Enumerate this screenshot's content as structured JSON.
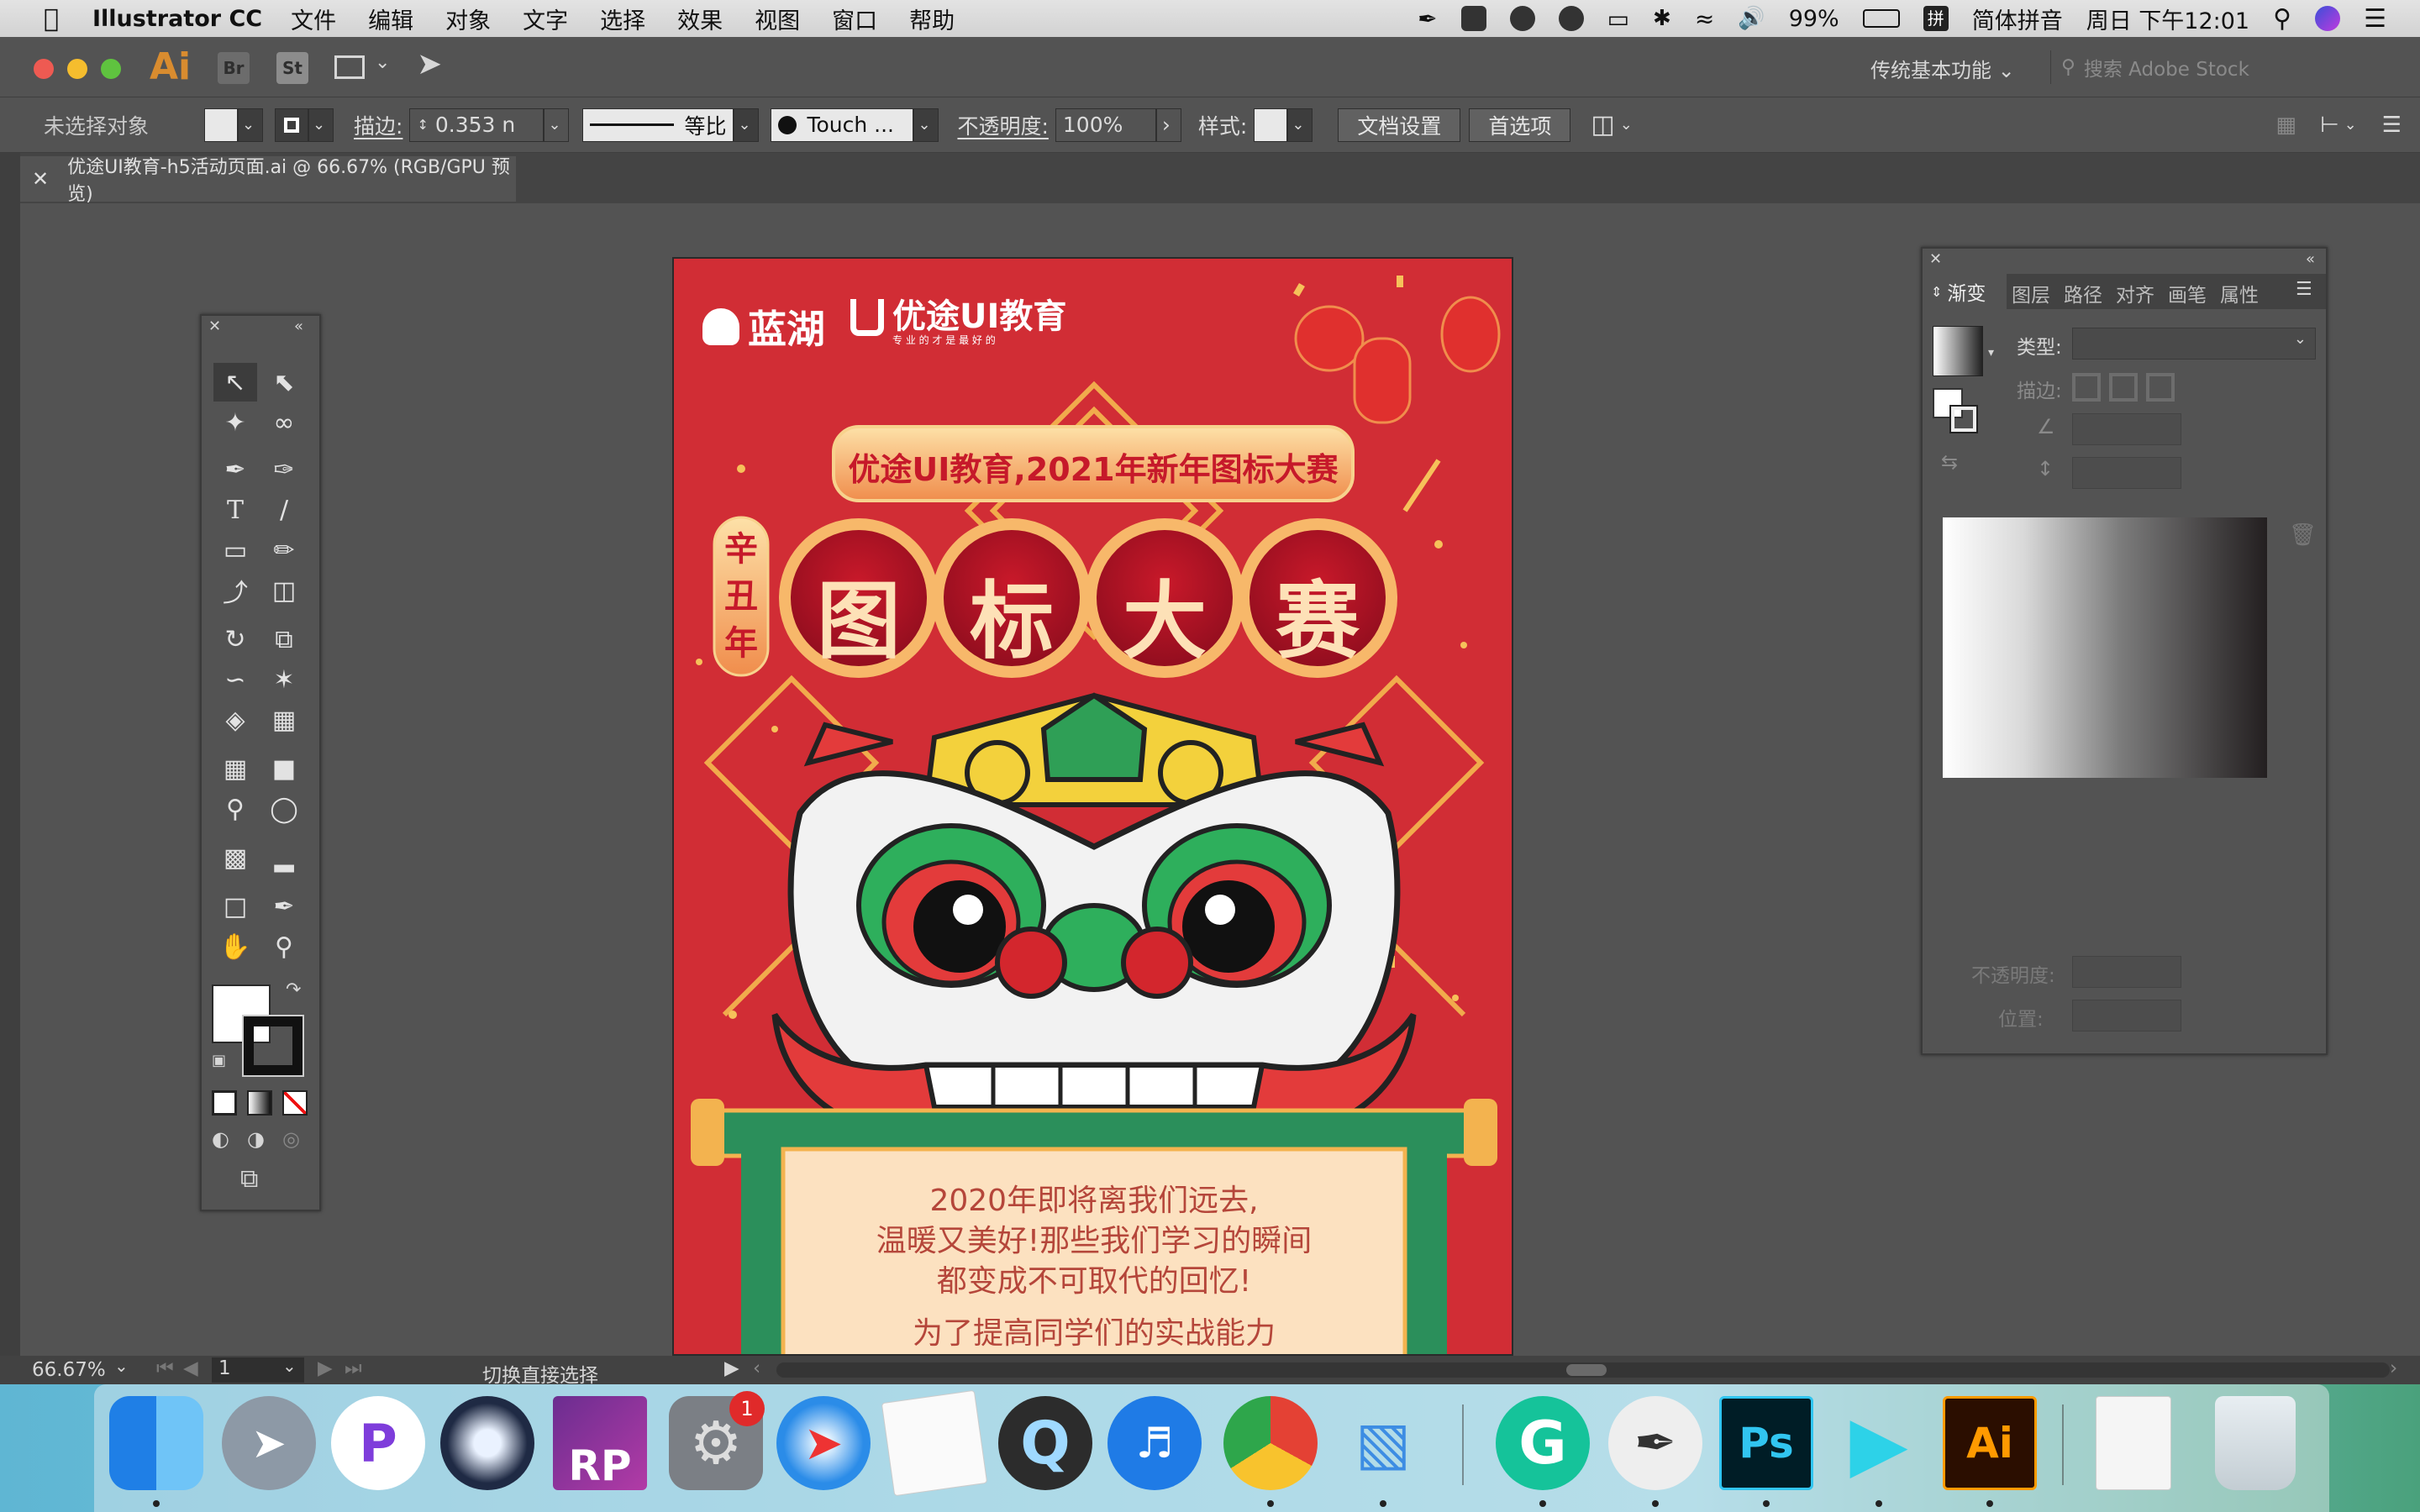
{
  "menubar": {
    "app_name": "Illustrator CC",
    "items": [
      "文件",
      "编辑",
      "对象",
      "文字",
      "选择",
      "效果",
      "视图",
      "窗口",
      "帮助"
    ],
    "battery": "99%",
    "input_method": "简体拼音",
    "datetime": "周日 下午12:01"
  },
  "appbar": {
    "logo": "Ai",
    "bridge": "Br",
    "stock": "St",
    "workspace": "传统基本功能",
    "search_placeholder": "搜索 Adobe Stock"
  },
  "controlbar": {
    "selection": "未选择对象",
    "stroke_label": "描边:",
    "stroke_value": "0.353 n",
    "stroke_profile": "等比",
    "brush": "Touch ...",
    "opacity_label": "不透明度:",
    "opacity_value": "100%",
    "style_label": "样式:",
    "doc_setup": "文档设置",
    "preferences": "首选项"
  },
  "document": {
    "tab_title": "优途UI教育-h5活动页面.ai @ 66.67% (RGB/GPU 预览)"
  },
  "artwork": {
    "brand1": "蓝湖",
    "brand2": "优途UI教育",
    "brand2_tagline": "专 业 的 才 是 最 好 的",
    "banner": "优途UI教育,2021年新年图标大赛",
    "year_label": [
      "辛",
      "丑",
      "年"
    ],
    "title_chars": [
      "图",
      "标",
      "大",
      "赛"
    ],
    "scroll_lines": [
      "2020年即将离我们远去,",
      "温暖又美好!那些我们学习的瞬间",
      "都变成不可取代的回忆!",
      "为了提高同学们的实战能力"
    ]
  },
  "gradient_panel": {
    "tabs": [
      "渐变",
      "图层",
      "路径",
      "对齐",
      "画笔",
      "属性"
    ],
    "type_label": "类型:",
    "stroke_label": "描边:",
    "opacity_label": "不透明度:",
    "position_label": "位置:"
  },
  "statusbar": {
    "zoom": "66.67%",
    "page": "1",
    "tool_hint": "切换直接选择"
  },
  "dock": {
    "rp_label": "RP",
    "ps_label": "Ps",
    "ai_label": "Ai",
    "badge": "1"
  }
}
